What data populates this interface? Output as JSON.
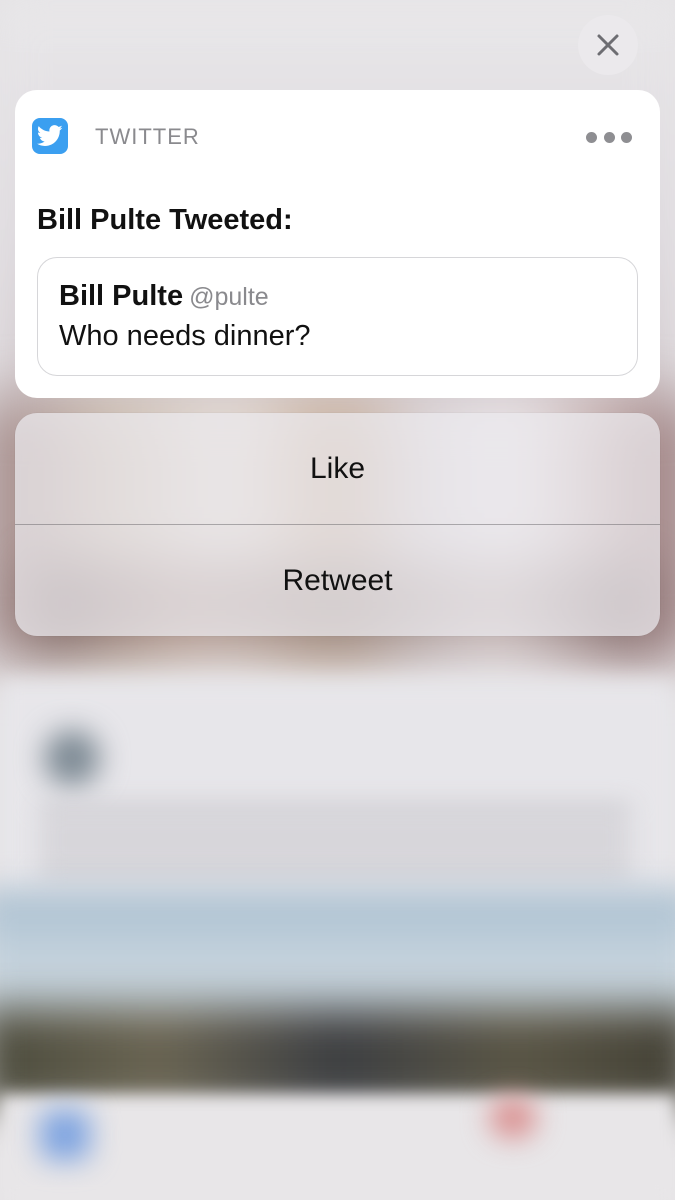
{
  "notification": {
    "app_name": "TWITTER",
    "app_icon": "twitter-bird-icon",
    "title": "Bill Pulte Tweeted:",
    "tweet": {
      "author_name": "Bill Pulte",
      "author_handle": "@pulte",
      "text": "Who needs dinner?"
    }
  },
  "actions": [
    {
      "label": "Like"
    },
    {
      "label": "Retweet"
    }
  ],
  "controls": {
    "close_icon": "close-icon",
    "more_icon": "more-options-icon"
  },
  "colors": {
    "twitter_blue": "#3b9ff0",
    "card_background": "#ffffff",
    "secondary_text": "#8a8a8e"
  }
}
